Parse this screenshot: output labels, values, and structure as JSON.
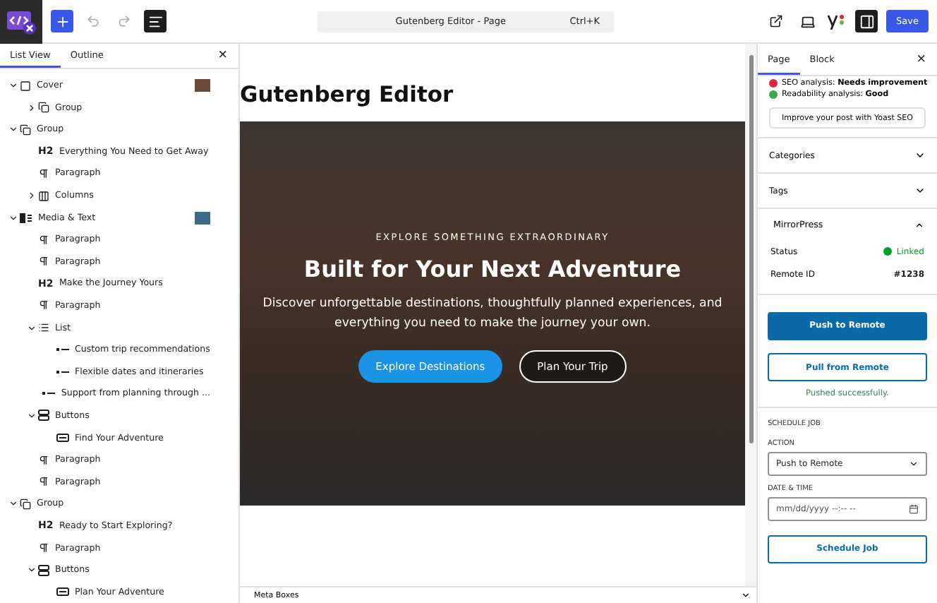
{
  "topbar": {
    "command": {
      "title": "Gutenberg Editor - Page",
      "shortcut": "Ctrl+K"
    },
    "list_view_on": true,
    "sidebar_on": true,
    "save": "Save"
  },
  "left_panel": {
    "tabs": [
      {
        "label": "List View",
        "selected": true
      },
      {
        "label": "Outline",
        "selected": false
      }
    ],
    "close": "×",
    "tree": [
      {
        "kind": "cover",
        "label": "Cover",
        "expanded": true,
        "thumbnail": true,
        "children": [
          {
            "kind": "group",
            "label": "Group",
            "expanded": false
          }
        ]
      },
      {
        "kind": "group",
        "label": "Group",
        "expanded": true,
        "children": [
          {
            "kind": "heading",
            "level": "H2",
            "label": "Everything You Need to Get Away"
          },
          {
            "kind": "paragraph",
            "label": "Paragraph"
          },
          {
            "kind": "columns",
            "label": "Columns",
            "expanded": false
          }
        ]
      },
      {
        "kind": "media",
        "label": "Media & Text",
        "expanded": true,
        "thumbnail": true,
        "children": [
          {
            "kind": "paragraph",
            "label": "Paragraph"
          },
          {
            "kind": "paragraph",
            "label": "Paragraph"
          },
          {
            "kind": "heading",
            "level": "H2",
            "label": "Make the Journey Yours"
          },
          {
            "kind": "paragraph",
            "label": "Paragraph"
          },
          {
            "kind": "list",
            "label": "List",
            "expanded": true,
            "children": [
              {
                "kind": "list-item",
                "label": "Custom trip recommendations"
              },
              {
                "kind": "list-item",
                "label": "Flexible dates and itineraries"
              },
              {
                "kind": "list-item",
                "label": "Support from planning through ..."
              }
            ]
          },
          {
            "kind": "buttons",
            "label": "Buttons",
            "expanded": true,
            "children": [
              {
                "kind": "button",
                "label": "Find Your Adventure"
              }
            ]
          },
          {
            "kind": "paragraph",
            "label": "Paragraph"
          },
          {
            "kind": "paragraph",
            "label": "Paragraph"
          }
        ]
      },
      {
        "kind": "group",
        "label": "Group",
        "expanded": true,
        "children": [
          {
            "kind": "heading",
            "level": "H2",
            "label": "Ready to Start Exploring?"
          },
          {
            "kind": "paragraph",
            "label": "Paragraph"
          },
          {
            "kind": "buttons",
            "label": "Buttons",
            "expanded": true,
            "children": [
              {
                "kind": "button",
                "label": "Plan Your Adventure"
              }
            ]
          }
        ]
      }
    ]
  },
  "canvas": {
    "page_title": "Gutenberg Editor",
    "hero": {
      "eyebrow": "EXPLORE SOMETHING EXTRAORDINARY",
      "heading": "Built for Your Next Adventure",
      "text": "Discover unforgettable destinations, thoughtfully planned experiences, and everything you need to make the journey your own.",
      "buttons": [
        {
          "label": "Explore Destinations",
          "kind": "primary"
        },
        {
          "label": "Plan Your Trip",
          "kind": "outline"
        }
      ]
    },
    "meta_boxes": "Meta Boxes"
  },
  "sidebar": {
    "tabs": [
      {
        "label": "Page",
        "selected": true
      },
      {
        "label": "Block",
        "selected": false
      }
    ],
    "close": "×",
    "seo": [
      {
        "label": "SEO analysis: ",
        "value": "Needs improvement",
        "color": "#e0263b"
      },
      {
        "label": "Readability analysis: ",
        "value": "Good",
        "color": "#3aa84a"
      }
    ],
    "yoast_button": "Improve your post with Yoast SEO",
    "sections": [
      {
        "label": "Categories",
        "expanded": false
      },
      {
        "label": "Tags",
        "expanded": false
      }
    ],
    "mirrorpress": {
      "title": "MirrorPress",
      "expanded": true,
      "rows": [
        {
          "label": "Status",
          "value": "Linked",
          "kind": "status",
          "color": "#00a32a"
        },
        {
          "label": "Remote ID",
          "value": "#1238",
          "kind": "text"
        }
      ],
      "push": "Push to Remote",
      "pull": "Pull from Remote",
      "message": "Pushed successfully.",
      "schedule": {
        "heading": "SCHEDULE JOB",
        "action_label": "ACTION",
        "action_value": "Push to Remote",
        "date_label": "DATE & TIME",
        "date_placeholder": "mm/dd/yyyy --:-- --",
        "button": "Schedule Job"
      }
    }
  }
}
